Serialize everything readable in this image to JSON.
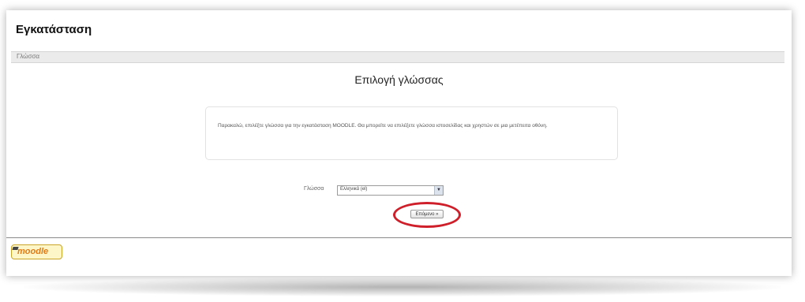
{
  "header": {
    "title": "Εγκατάσταση"
  },
  "breadcrumb": {
    "text": "Γλώσσα"
  },
  "main": {
    "heading": "Επιλογή γλώσσας",
    "info_text": "Παρακαλώ, επιλέξτε γλώσσα για την εγκατάσταση MOODLE. Θα μπορείτε να επιλέξετε γλώσσα ιστοσελίδας και χρηστών σε μια μετέπειτα οθόνη.",
    "language_label": "Γλώσσα",
    "language_selected": "Ελληνικά (el)",
    "next_button_label": "Επόμενο »"
  },
  "footer": {
    "logo_text": "moodle"
  },
  "colors": {
    "highlight_ring": "#cf1f2b",
    "logo_orange": "#e07b17"
  },
  "icons": {
    "select_arrow": "chevron-down-icon"
  }
}
